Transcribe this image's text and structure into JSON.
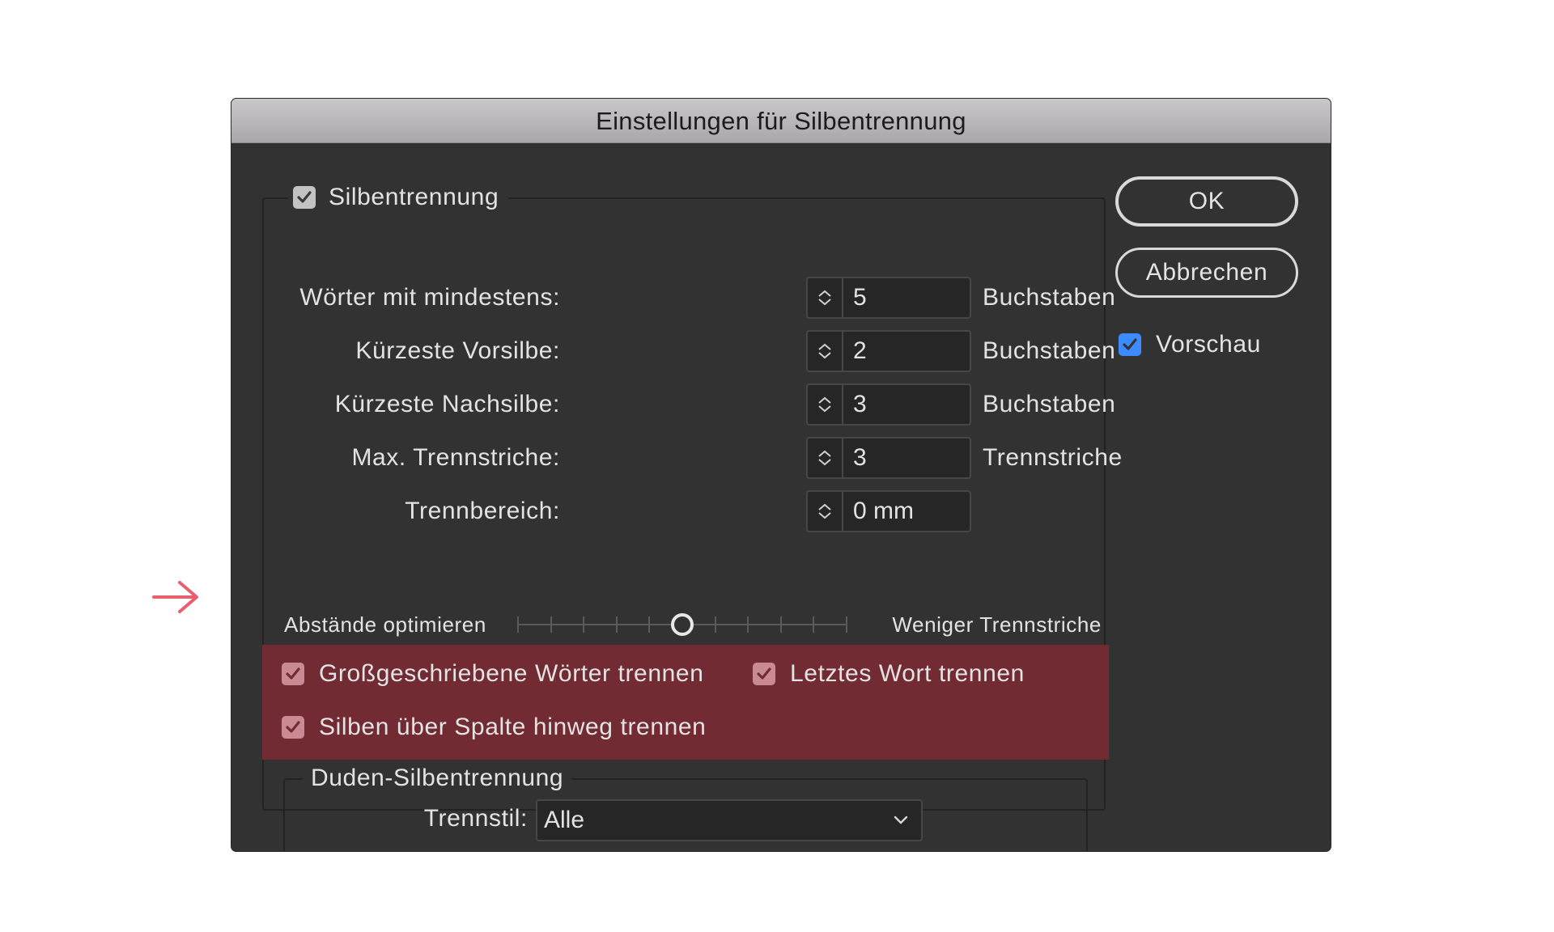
{
  "dialog": {
    "title": "Einstellungen für Silbentrennung"
  },
  "hyphenation": {
    "enabled": true,
    "label": "Silbentrennung",
    "fields": [
      {
        "label": "Wörter mit mindestens:",
        "value": "5",
        "unit": "Buchstaben"
      },
      {
        "label": "Kürzeste Vorsilbe:",
        "value": "2",
        "unit": "Buchstaben"
      },
      {
        "label": "Kürzeste Nachsilbe:",
        "value": "3",
        "unit": "Buchstaben"
      },
      {
        "label": "Max. Trennstriche:",
        "value": "3",
        "unit": "Trennstriche"
      },
      {
        "label": "Trennbereich:",
        "value": "0 mm",
        "unit": ""
      }
    ],
    "slider": {
      "left_label": "Abstände optimieren",
      "right_label": "Weniger Trennstriche",
      "ticks": 11,
      "value_index": 5
    },
    "options": [
      {
        "label": "Großgeschriebene Wörter trennen",
        "checked": true
      },
      {
        "label": "Letztes Wort trennen",
        "checked": true
      },
      {
        "label": "Silben über Spalte hinweg trennen",
        "checked": true
      }
    ],
    "duden": {
      "label": "Duden-Silbentrennung",
      "style_label": "Trennstil:",
      "style_value": "Alle"
    }
  },
  "buttons": {
    "ok": "OK",
    "cancel": "Abbrechen"
  },
  "preview": {
    "label": "Vorschau",
    "checked": true
  },
  "colors": {
    "dialog_bg": "#323232",
    "highlight": "#722b33",
    "arrow": "#e8606e",
    "preview_check": "#3d8bff"
  }
}
